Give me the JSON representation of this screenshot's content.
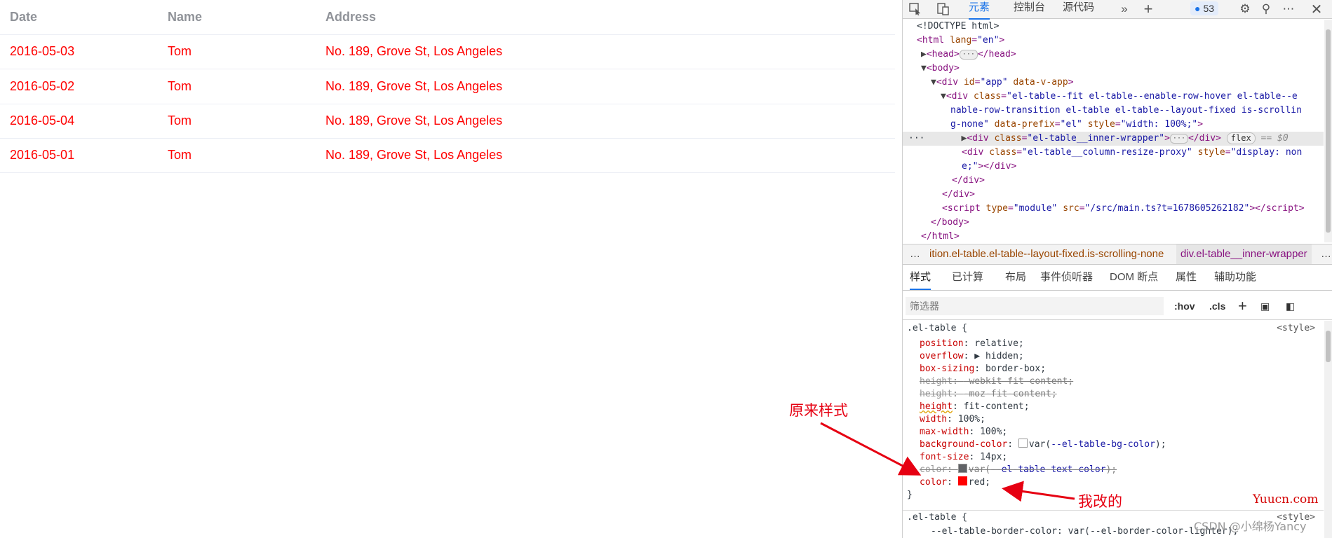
{
  "table": {
    "columns": [
      "Date",
      "Name",
      "Address"
    ],
    "rows": [
      {
        "date": "2016-05-03",
        "name": "Tom",
        "address": "No. 189, Grove St, Los Angeles"
      },
      {
        "date": "2016-05-02",
        "name": "Tom",
        "address": "No. 189, Grove St, Los Angeles"
      },
      {
        "date": "2016-05-04",
        "name": "Tom",
        "address": "No. 189, Grove St, Los Angeles"
      },
      {
        "date": "2016-05-01",
        "name": "Tom",
        "address": "No. 189, Grove St, Los Angeles"
      }
    ],
    "text_color": "#ff0000"
  },
  "devtools": {
    "tabs": [
      "元素",
      "控制台",
      "源代码"
    ],
    "issues_count": "53",
    "icons": [
      "inspect-icon",
      "device-toggle-icon",
      "more-tabs-icon",
      "add-tab-icon",
      "issues-icon",
      "settings-icon",
      "customize-icon",
      "more-options-icon",
      "close-icon"
    ],
    "dom": {
      "doctype": "<!DOCTYPE html>",
      "html_tag": "html",
      "html_attr": "lang",
      "html_val": "\"en\"",
      "head_tag": "head",
      "body_tag": "body",
      "app_attr_id": "id",
      "app_val_id": "\"app\"",
      "app_attr_v": "data-v-app",
      "table_class_val_1": "\"el-table--fit el-table--enable-row-hover el-table--e",
      "table_class_val_2": "nable-row-transition el-table el-table--layout-fixed is-scrollin",
      "table_class_val_3": "g-none\"",
      "table_prefix_attr": "data-prefix",
      "table_prefix_val": "\"el\"",
      "table_style_attr": "style",
      "table_style_val": "\"width: 100%;\"",
      "inner_class_val": "\"el-table__inner-wrapper\"",
      "flex_badge": "flex",
      "selected_marker": "== $0",
      "proxy_class_val": "\"el-table__column-resize-proxy\"",
      "proxy_style_attr": "style",
      "proxy_style_val_1": "\"display: non",
      "proxy_style_val_2": "e;\"",
      "script_type_val": "\"module\"",
      "script_src_val": "\"/src/main.ts?t=1678605262182\"",
      "html_close": "</html>"
    },
    "breadcrumb": {
      "ellipsis": "…",
      "item1": "ition.el-table.el-table--layout-fixed.is-scrolling-none",
      "item2": "div.el-table__inner-wrapper",
      "more": "…"
    },
    "style_tabs": [
      "样式",
      "已计算",
      "布局",
      "事件侦听器",
      "DOM 断点",
      "属性",
      "辅助功能"
    ],
    "filter_placeholder": "筛选器",
    "filter_buttons": [
      ":hov",
      ".cls"
    ],
    "rule": {
      "selector": ".el-table {",
      "source": "<style>",
      "declarations": [
        {
          "prop": "position",
          "value": "relative;"
        },
        {
          "prop": "overflow",
          "value": "hidden;"
        },
        {
          "prop": "box-sizing",
          "value": "border-box;"
        },
        {
          "prop": "height",
          "value": "-webkit-fit-content;",
          "struck": true
        },
        {
          "prop": "height",
          "value": "-moz-fit-content;",
          "struck": true
        },
        {
          "prop": "height",
          "value": "fit-content;"
        },
        {
          "prop": "width",
          "value": "100%;"
        },
        {
          "prop": "max-width",
          "value": "100%;"
        },
        {
          "prop": "background-color",
          "value_pre": "var(",
          "value_var": "--el-table-bg-color",
          "value_post": ");"
        },
        {
          "prop": "font-size",
          "value": "14px;"
        },
        {
          "prop": "color",
          "value_pre": "var(",
          "value_var": "--el-table-text-color",
          "value_post": ");",
          "struck": true
        },
        {
          "prop": "color",
          "value": "red;"
        }
      ],
      "close": "}",
      "next_selector": ".el-table {",
      "next_source": "<style>",
      "next_partial": "--el-table-border-color: var(--el-border-color-lighter);"
    }
  },
  "annotations": {
    "original_style": "原来样式",
    "my_change": "我改的"
  },
  "watermarks": {
    "site": "Yuucn.com",
    "author": "CSDN @小绵杨Yancy"
  },
  "colors": {
    "annotation_red": "#e60012",
    "devtools_accent": "#1a73e8"
  }
}
